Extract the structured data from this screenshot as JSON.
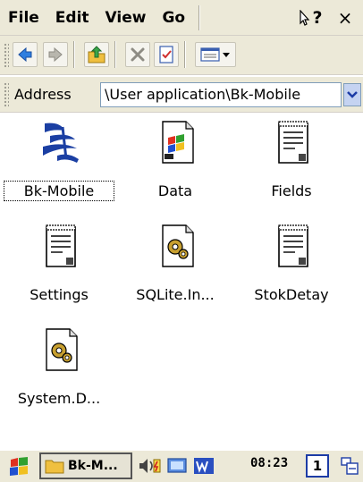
{
  "menu": {
    "file": "File",
    "edit": "Edit",
    "view": "View",
    "go": "Go",
    "help_label": "?",
    "close_label": "×"
  },
  "toolbar": {
    "icons": [
      "back-icon",
      "forward-icon",
      "up-folder-icon",
      "delete-icon",
      "properties-icon",
      "view-menu-icon"
    ]
  },
  "address": {
    "label": "Address",
    "value": "\\User application\\Bk-Mobile"
  },
  "files": [
    {
      "name": "Bk-Mobile",
      "icon": "app-logo-icon",
      "selected": true
    },
    {
      "name": "Data",
      "icon": "windows-flag-doc-icon"
    },
    {
      "name": "Fields",
      "icon": "text-document-icon"
    },
    {
      "name": "Settings",
      "icon": "text-document-icon"
    },
    {
      "name": "SQLite.In...",
      "icon": "gear-document-icon"
    },
    {
      "name": "StokDetay",
      "icon": "text-document-icon"
    },
    {
      "name": "System.D...",
      "icon": "gear-document-icon"
    }
  ],
  "taskbar": {
    "task_label": "Bk-M...",
    "clock": "08:23",
    "ime": "1"
  },
  "colors": {
    "chrome": "#ece9d8",
    "accent": "#1d3ca6"
  }
}
